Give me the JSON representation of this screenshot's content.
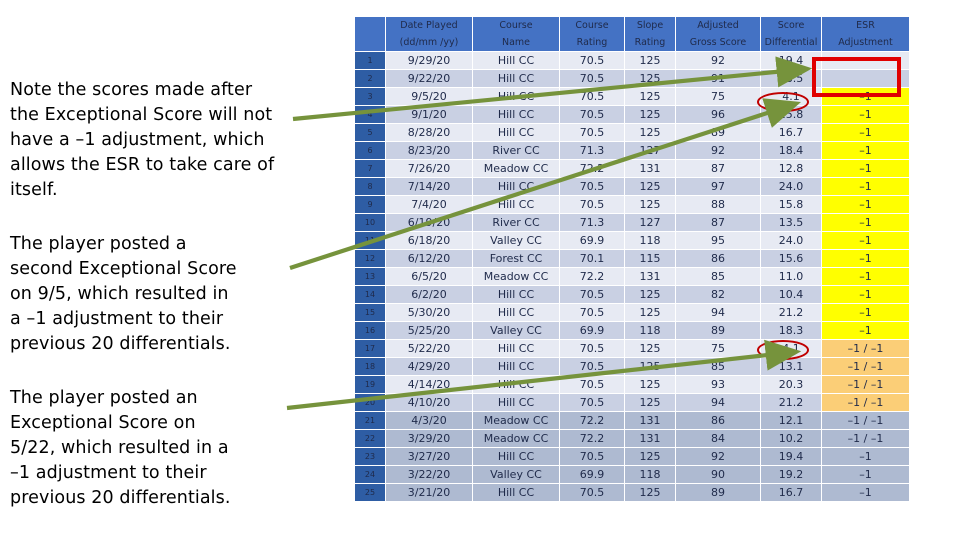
{
  "notes": [
    "Note the scores made after\nthe Exceptional Score will not\nhave a –1 adjustment, which\nallows the ESR to take care of\nitself.",
    "The player posted a\nsecond Exceptional Score\non 9/5, which resulted in\na –1 adjustment to their\nprevious 20 differentials.",
    "The player posted an\nExceptional Score on\n5/22, which resulted in a\n–1 adjustment to their\nprevious 20 differentials."
  ],
  "table": {
    "columns": [
      {
        "line1": "",
        "line2": ""
      },
      {
        "line1": "Date Played",
        "line2": "(dd/mm /yy)"
      },
      {
        "line1": "Course",
        "line2": "Name"
      },
      {
        "line1": "Course",
        "line2": "Rating"
      },
      {
        "line1": "Slope",
        "line2": "Rating"
      },
      {
        "line1": "Adjusted",
        "line2": "Gross Score"
      },
      {
        "line1": "Score",
        "line2": "Differential"
      },
      {
        "line1": "ESR",
        "line2": "Adjustment"
      }
    ],
    "rows": [
      {
        "idx": "1",
        "date": "9/29/20",
        "course": "Hill CC",
        "crating": "70.5",
        "srating": "125",
        "ags": "92",
        "diff": "19.4",
        "esr": "",
        "esr_style": "plain"
      },
      {
        "idx": "2",
        "date": "9/22/20",
        "course": "Hill CC",
        "crating": "70.5",
        "srating": "125",
        "ags": "91",
        "diff": "18.5",
        "esr": "",
        "esr_style": "plain"
      },
      {
        "idx": "3",
        "date": "9/5/20",
        "course": "Hill CC",
        "crating": "70.5",
        "srating": "125",
        "ags": "75",
        "diff": "4.1",
        "esr": "–1",
        "esr_style": "yellow"
      },
      {
        "idx": "4",
        "date": "9/1/20",
        "course": "Hill CC",
        "crating": "70.5",
        "srating": "125",
        "ags": "96",
        "diff": "25.8",
        "esr": "–1",
        "esr_style": "yellow"
      },
      {
        "idx": "5",
        "date": "8/28/20",
        "course": "Hill CC",
        "crating": "70.5",
        "srating": "125",
        "ags": "89",
        "diff": "16.7",
        "esr": "–1",
        "esr_style": "yellow"
      },
      {
        "idx": "6",
        "date": "8/23/20",
        "course": "River CC",
        "crating": "71.3",
        "srating": "127",
        "ags": "92",
        "diff": "18.4",
        "esr": "–1",
        "esr_style": "yellow"
      },
      {
        "idx": "7",
        "date": "7/26/20",
        "course": "Meadow CC",
        "crating": "72.2",
        "srating": "131",
        "ags": "87",
        "diff": "12.8",
        "esr": "–1",
        "esr_style": "yellow"
      },
      {
        "idx": "8",
        "date": "7/14/20",
        "course": "Hill CC",
        "crating": "70.5",
        "srating": "125",
        "ags": "97",
        "diff": "24.0",
        "esr": "–1",
        "esr_style": "yellow"
      },
      {
        "idx": "9",
        "date": "7/4/20",
        "course": "Hill CC",
        "crating": "70.5",
        "srating": "125",
        "ags": "88",
        "diff": "15.8",
        "esr": "–1",
        "esr_style": "yellow"
      },
      {
        "idx": "10",
        "date": "6/19/20",
        "course": "River CC",
        "crating": "71.3",
        "srating": "127",
        "ags": "87",
        "diff": "13.5",
        "esr": "–1",
        "esr_style": "yellow"
      },
      {
        "idx": "11",
        "date": "6/18/20",
        "course": "Valley CC",
        "crating": "69.9",
        "srating": "118",
        "ags": "95",
        "diff": "24.0",
        "esr": "–1",
        "esr_style": "yellow"
      },
      {
        "idx": "12",
        "date": "6/12/20",
        "course": "Forest CC",
        "crating": "70.1",
        "srating": "115",
        "ags": "86",
        "diff": "15.6",
        "esr": "–1",
        "esr_style": "yellow"
      },
      {
        "idx": "13",
        "date": "6/5/20",
        "course": "Meadow CC",
        "crating": "72.2",
        "srating": "131",
        "ags": "85",
        "diff": "11.0",
        "esr": "–1",
        "esr_style": "yellow"
      },
      {
        "idx": "14",
        "date": "6/2/20",
        "course": "Hill CC",
        "crating": "70.5",
        "srating": "125",
        "ags": "82",
        "diff": "10.4",
        "esr": "–1",
        "esr_style": "yellow"
      },
      {
        "idx": "15",
        "date": "5/30/20",
        "course": "Hill CC",
        "crating": "70.5",
        "srating": "125",
        "ags": "94",
        "diff": "21.2",
        "esr": "–1",
        "esr_style": "yellow"
      },
      {
        "idx": "16",
        "date": "5/25/20",
        "course": "Valley CC",
        "crating": "69.9",
        "srating": "118",
        "ags": "89",
        "diff": "18.3",
        "esr": "–1",
        "esr_style": "yellow"
      },
      {
        "idx": "17",
        "date": "5/22/20",
        "course": "Hill CC",
        "crating": "70.5",
        "srating": "125",
        "ags": "75",
        "diff": "4.1",
        "esr": "–1 / –1",
        "esr_style": "orange"
      },
      {
        "idx": "18",
        "date": "4/29/20",
        "course": "Hill CC",
        "crating": "70.5",
        "srating": "125",
        "ags": "85",
        "diff": "13.1",
        "esr": "–1 / –1",
        "esr_style": "orange"
      },
      {
        "idx": "19",
        "date": "4/14/20",
        "course": "Hill CC",
        "crating": "70.5",
        "srating": "125",
        "ags": "93",
        "diff": "20.3",
        "esr": "–1 / –1",
        "esr_style": "orange"
      },
      {
        "idx": "20",
        "date": "4/10/20",
        "course": "Hill CC",
        "crating": "70.5",
        "srating": "125",
        "ags": "94",
        "diff": "21.2",
        "esr": "–1 / –1",
        "esr_style": "orange"
      },
      {
        "idx": "21",
        "date": "4/3/20",
        "course": "Meadow CC",
        "crating": "72.2",
        "srating": "131",
        "ags": "86",
        "diff": "12.1",
        "esr": "–1 / –1",
        "esr_style": "plain"
      },
      {
        "idx": "22",
        "date": "3/29/20",
        "course": "Meadow CC",
        "crating": "72.2",
        "srating": "131",
        "ags": "84",
        "diff": "10.2",
        "esr": "–1 / –1",
        "esr_style": "plain"
      },
      {
        "idx": "23",
        "date": "3/27/20",
        "course": "Hill CC",
        "crating": "70.5",
        "srating": "125",
        "ags": "92",
        "diff": "19.4",
        "esr": "–1",
        "esr_style": "plain"
      },
      {
        "idx": "24",
        "date": "3/22/20",
        "course": "Valley CC",
        "crating": "69.9",
        "srating": "118",
        "ags": "90",
        "diff": "19.2",
        "esr": "–1",
        "esr_style": "plain"
      },
      {
        "idx": "25",
        "date": "3/21/20",
        "course": "Hill CC",
        "crating": "70.5",
        "srating": "125",
        "ags": "89",
        "diff": "16.7",
        "esr": "–1",
        "esr_style": "plain"
      }
    ]
  },
  "annotations": {
    "red_box_label": "ESR adjustment blank for rows 1-2",
    "ellipse_1_label": "Exceptional score differential 4.1 on 9/5",
    "ellipse_2_label": "Exceptional score differential 4.1 on 5/22",
    "arrow_color": "#76933c",
    "highlight_box_color": "#e00000",
    "ellipse_color": "#c00000",
    "header_color": "#4472c4",
    "yellow_color": "#ffff00",
    "orange_color": "#fbce77"
  }
}
